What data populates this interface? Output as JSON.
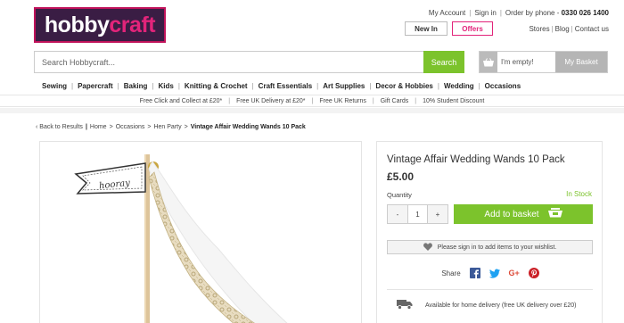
{
  "header": {
    "logo": {
      "part1": "hobby",
      "part2": "craft"
    },
    "toplinks": {
      "account": "My Account",
      "signin": "Sign in",
      "order_prefix": "Order by phone - ",
      "phone": "0330 026 1400"
    },
    "new_in": "New In",
    "offers": "Offers",
    "storelinks": {
      "stores": "Stores",
      "blog": "Blog",
      "contact": "Contact us"
    }
  },
  "search": {
    "placeholder": "Search Hobbycraft...",
    "button": "Search"
  },
  "basket": {
    "status": "I'm empty!",
    "label": "My Basket"
  },
  "nav": [
    "Sewing",
    "Papercraft",
    "Baking",
    "Kids",
    "Knitting & Crochet",
    "Craft Essentials",
    "Art Supplies",
    "Decor & Hobbies",
    "Wedding",
    "Occasions"
  ],
  "promo": [
    "Free Click and Collect at £20*",
    "Free UK Delivery at £20*",
    "Free UK Returns",
    "Gift Cards",
    "10% Student Discount"
  ],
  "breadcrumb": {
    "back": "Back to Results",
    "home": "Home",
    "occasions": "Occasions",
    "hen_party": "Hen Party",
    "current": "Vintage Affair Wedding Wands 10 Pack"
  },
  "product_image": {
    "flag_text": "hooray"
  },
  "product": {
    "title": "Vintage Affair Wedding Wands 10 Pack",
    "price": "£5.00",
    "quantity_label": "Quantity",
    "stock": "In Stock",
    "qty_minus": "-",
    "qty_value": "1",
    "qty_plus": "+",
    "add_to_basket": "Add to basket",
    "wishlist": "Please sign in to add items to your wishlist.",
    "share_label": "Share",
    "delivery": "Available for home delivery (free UK delivery over £20)"
  },
  "colors": {
    "brand_purple": "#3a1d44",
    "brand_pink": "#e2247a",
    "accent_green": "#7cc32c"
  }
}
